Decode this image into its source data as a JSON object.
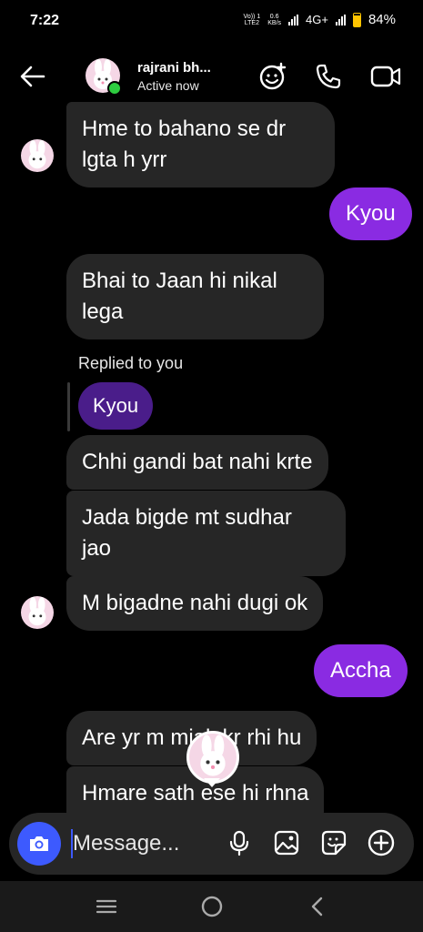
{
  "status_bar": {
    "time": "7:22",
    "volte_top": "Vo)) 1",
    "volte_bottom": "LTE2",
    "speed_value": "0.6",
    "speed_unit": "KB/s",
    "network": "4G+",
    "battery": "84%"
  },
  "header": {
    "name": "rajrani bh...",
    "status": "Active now",
    "icons": [
      "back-arrow-icon",
      "effects-icon",
      "phone-icon",
      "video-call-icon"
    ]
  },
  "messages": [
    {
      "side": "in",
      "text": "Hme to bahano se dr\nlgta h yrr"
    },
    {
      "side": "out",
      "text": "Kyou"
    },
    {
      "side": "in",
      "text": "Bhai to Jaan hi nikal\nlega"
    },
    {
      "side": "in",
      "reply_label": "Replied to you",
      "reply_quote": "Kyou",
      "text": "Chhi gandi bat nahi krte"
    },
    {
      "side": "in",
      "text": "Jada bigde mt sudhar\njao"
    },
    {
      "side": "in",
      "text": "M bigadne nahi dugi ok"
    },
    {
      "side": "out",
      "text": "Accha"
    },
    {
      "side": "in",
      "text": "Are yr m mjak kr rhi hu"
    },
    {
      "side": "in",
      "text": "Hmare sath ese hi rhna"
    }
  ],
  "composer": {
    "placeholder": "Message...",
    "icons": [
      "camera-icon",
      "microphone-icon",
      "gallery-icon",
      "sticker-icon",
      "plus-icon"
    ]
  },
  "colors": {
    "outgoing_bubble": "#8a2be2",
    "incoming_bubble": "#262626",
    "reply_bubble": "#4a1d8a",
    "camera_button": "#3d5afe",
    "online_dot": "#2ecc40",
    "battery": "#ffc400"
  }
}
